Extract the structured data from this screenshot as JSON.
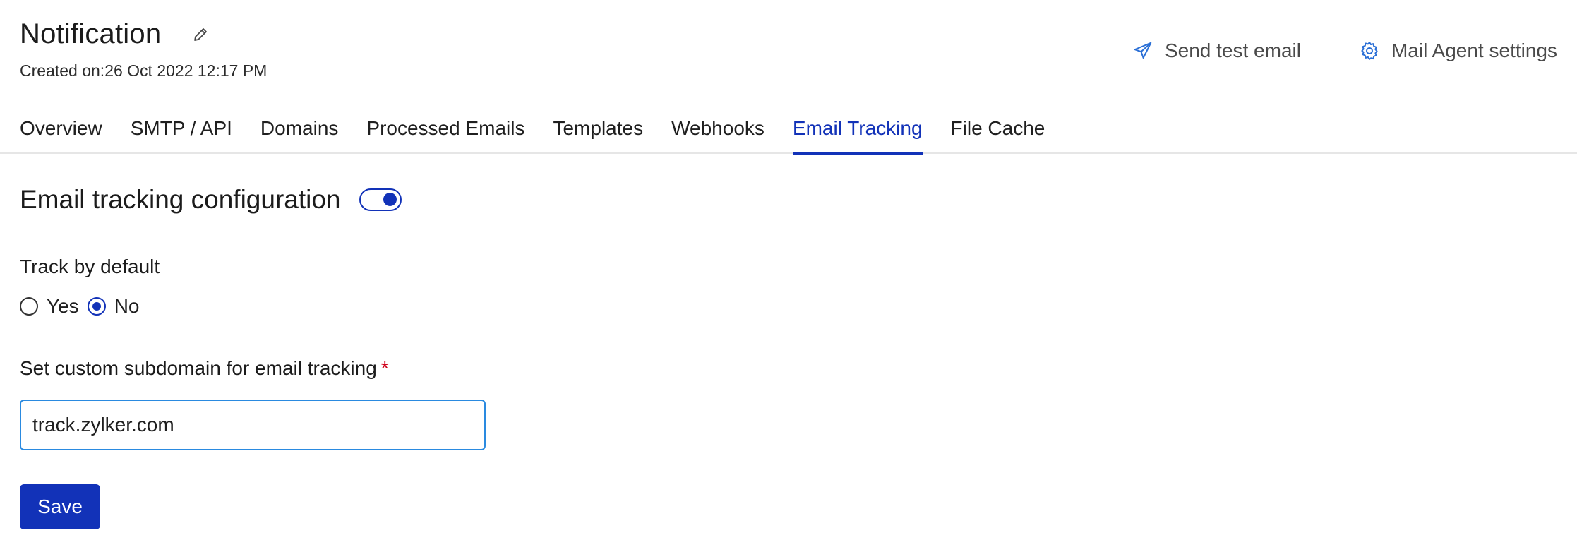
{
  "header": {
    "title": "Notification",
    "created_on": "Created on:26 Oct 2022 12:17 PM",
    "edit_icon": "pencil-icon"
  },
  "actions": {
    "send_test_email": "Send test email",
    "send_icon": "paper-plane-icon",
    "mail_agent_settings": "Mail Agent settings",
    "settings_icon": "gear-icon"
  },
  "tabs": [
    {
      "label": "Overview",
      "active": false
    },
    {
      "label": "SMTP / API",
      "active": false
    },
    {
      "label": "Domains",
      "active": false
    },
    {
      "label": "Processed Emails",
      "active": false
    },
    {
      "label": "Templates",
      "active": false
    },
    {
      "label": "Webhooks",
      "active": false
    },
    {
      "label": "Email Tracking",
      "active": true
    },
    {
      "label": "File Cache",
      "active": false
    }
  ],
  "tracking": {
    "section_title": "Email tracking configuration",
    "toggle_on": true,
    "track_by_default_label": "Track by default",
    "options": [
      {
        "label": "Yes",
        "checked": false
      },
      {
        "label": "No",
        "checked": true
      }
    ],
    "subdomain_label": "Set custom subdomain for email tracking",
    "required_mark": "*",
    "subdomain_value": "track.zylker.com",
    "save_label": "Save"
  },
  "colors": {
    "accent": "#1232b8",
    "input_border": "#2a8ae0",
    "required": "#d0021b",
    "action_icon": "#2a6fd6"
  }
}
